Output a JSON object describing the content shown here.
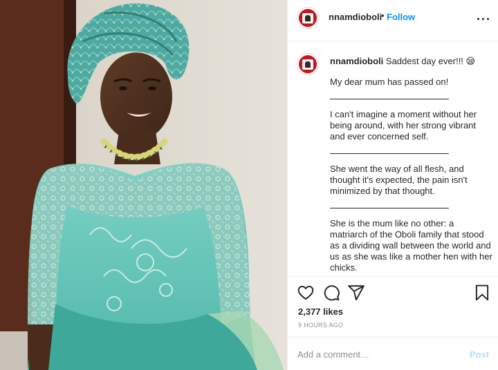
{
  "post": {
    "username": "nnamdioboli",
    "follow_separator": "•",
    "follow_label": "Follow",
    "photo_alt": "Woman in turquoise gele and lace dress"
  },
  "caption": {
    "username": "nnamdioboli",
    "headline": "Saddest day ever!!! 😪",
    "paragraphs": [
      "My dear mum has passed on!",
      "I can't imagine a moment without her being around, with her strong vibrant and ever concerned self.",
      "She went the way of all flesh, and thought it's expected, the pain isn't minimized by that thought.",
      "She is the mum like no other: a matriarch of the Oboli family that stood as a dividing wall between the world and us as she was like a mother hen with her chicks."
    ]
  },
  "stats": {
    "likes": "2,377 likes",
    "time": "9 HOURS AGO"
  },
  "comment": {
    "placeholder": "Add a comment…",
    "post_label": "Post"
  },
  "colors": {
    "accent": "#0095f6",
    "post_disabled": "#b2dffc",
    "muted": "#8e8e8e",
    "dress": "#62c5b8"
  },
  "icons": [
    "more-icon",
    "heart-icon",
    "comment-icon",
    "share-icon",
    "bookmark-icon"
  ]
}
